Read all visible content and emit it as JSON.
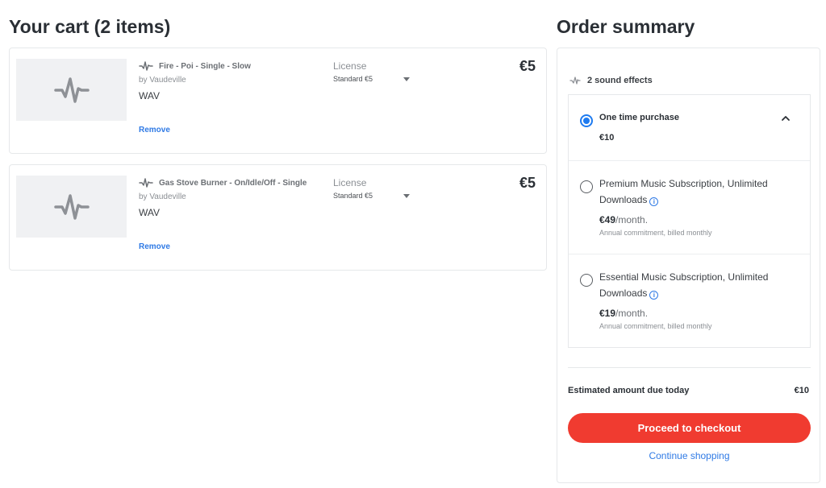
{
  "cart": {
    "title": "Your cart (2 items)",
    "items": [
      {
        "icon": "waveform-icon",
        "title": "Fire - Poi - Single - Slow",
        "author": "by Vaudeville",
        "format": "WAV",
        "remove_label": "Remove",
        "license_label": "License",
        "license_value": "Standard €5",
        "price": "€5"
      },
      {
        "icon": "waveform-icon",
        "title": "Gas Stove Burner - On/Idle/Off - Single",
        "author": "by Vaudeville",
        "format": "WAV",
        "remove_label": "Remove",
        "license_label": "License",
        "license_value": "Standard €5",
        "price": "€5"
      }
    ]
  },
  "summary": {
    "title": "Order summary",
    "count_label": "2 sound effects",
    "options": [
      {
        "title": "One time purchase",
        "price": "€10",
        "selected": true,
        "expanded": true
      },
      {
        "title": "Premium Music Subscription, Unlimited Downloads",
        "price": "€49",
        "period": "/month.",
        "note": "Annual commitment, billed monthly",
        "selected": false
      },
      {
        "title": "Essential Music Subscription, Unlimited Downloads",
        "price": "€19",
        "period": "/month.",
        "note": "Annual commitment, billed monthly",
        "selected": false
      }
    ],
    "due_label": "Estimated amount due today",
    "due_value": "€10",
    "checkout_label": "Proceed to checkout",
    "continue_label": "Continue shopping"
  },
  "colors": {
    "accent_blue": "#2f7ae5",
    "checkout_red": "#f03b30",
    "radio_selected": "#1e7bf0"
  }
}
